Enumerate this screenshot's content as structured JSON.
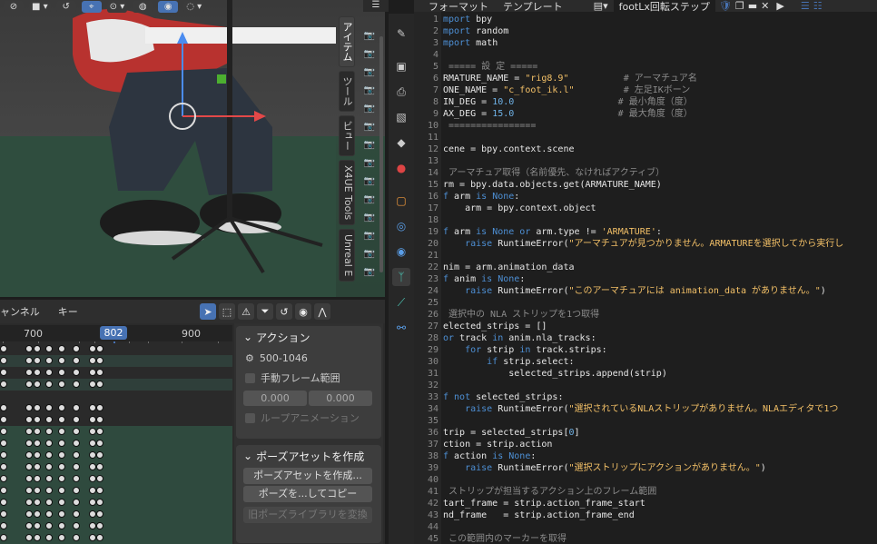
{
  "viewport": {
    "tabs": [
      "アイテム",
      "ツール",
      "ビュー",
      "X4UE Tools",
      "Unreal E"
    ]
  },
  "dopesheet": {
    "menu": [
      "ャンネル",
      "キー"
    ],
    "ruler": {
      "t700": "700",
      "t900": "900"
    },
    "current_frame": "802",
    "action_panel": {
      "title": "アクション",
      "range": "500-1046",
      "manual_range": "手動フレーム範囲",
      "start": "0.000",
      "end": "0.000",
      "loop": "ループアニメーション"
    },
    "pose_panel": {
      "title": "ポーズアセットを作成",
      "create": "ポーズアセットを作成...",
      "copy": "ポーズを...してコピー",
      "convert": "旧ポーズライブラリを変換"
    }
  },
  "editor": {
    "menu": [
      "フォーマット",
      "テンプレート"
    ],
    "filename": "footLx回転ステップ",
    "lines": [
      {
        "n": "1",
        "segs": [
          [
            "kw",
            "mport"
          ],
          [
            "",
            " bpy"
          ]
        ]
      },
      {
        "n": "2",
        "segs": [
          [
            "kw",
            "mport"
          ],
          [
            "",
            " random"
          ]
        ]
      },
      {
        "n": "3",
        "segs": [
          [
            "kw",
            "mport"
          ],
          [
            "",
            " math"
          ]
        ]
      },
      {
        "n": "4",
        "segs": []
      },
      {
        "n": "5",
        "segs": [
          [
            "cm",
            " ===== 設 定 ====="
          ]
        ]
      },
      {
        "n": "6",
        "segs": [
          [
            "",
            "RMATURE_NAME = "
          ],
          [
            "str",
            "\"rig8.9\""
          ],
          [
            "cm",
            "          # アーマチュア名"
          ]
        ]
      },
      {
        "n": "7",
        "segs": [
          [
            "",
            "ONE_NAME = "
          ],
          [
            "str",
            "\"c_foot_ik.l\""
          ],
          [
            "cm",
            "         # 左足IKボーン"
          ]
        ]
      },
      {
        "n": "8",
        "segs": [
          [
            "",
            "IN_DEG = "
          ],
          [
            "num",
            "10.0"
          ],
          [
            "cm",
            "                   # 最小角度（度）"
          ]
        ]
      },
      {
        "n": "9",
        "segs": [
          [
            "",
            "AX_DEG = "
          ],
          [
            "num",
            "15.0"
          ],
          [
            "cm",
            "                   # 最大角度（度）"
          ]
        ]
      },
      {
        "n": "10",
        "segs": [
          [
            "cm",
            " ================"
          ]
        ]
      },
      {
        "n": "11",
        "segs": []
      },
      {
        "n": "12",
        "segs": [
          [
            "",
            "cene = bpy.context.scene"
          ]
        ]
      },
      {
        "n": "13",
        "segs": []
      },
      {
        "n": "14",
        "segs": [
          [
            "cm",
            " アーマチュア取得（名前優先、なければアクティブ）"
          ]
        ]
      },
      {
        "n": "15",
        "segs": [
          [
            "",
            "rm = bpy.data.objects.get(ARMATURE_NAME)"
          ]
        ]
      },
      {
        "n": "16",
        "segs": [
          [
            "kw",
            "f"
          ],
          [
            "",
            " arm "
          ],
          [
            "kw",
            "is None"
          ],
          [
            "",
            ":"
          ]
        ]
      },
      {
        "n": "17",
        "segs": [
          [
            "",
            "    arm = bpy.context.object"
          ]
        ]
      },
      {
        "n": "18",
        "segs": []
      },
      {
        "n": "19",
        "segs": [
          [
            "kw",
            "f"
          ],
          [
            "",
            " arm "
          ],
          [
            "kw",
            "is None or"
          ],
          [
            "",
            " arm.type != "
          ],
          [
            "str",
            "'ARMATURE'"
          ],
          [
            "",
            ":"
          ]
        ]
      },
      {
        "n": "20",
        "segs": [
          [
            "",
            "    "
          ],
          [
            "kw",
            "raise"
          ],
          [
            "",
            " RuntimeError("
          ],
          [
            "str",
            "\"アーマチュアが見つかりません。ARMATUREを選択してから実行し"
          ]
        ]
      },
      {
        "n": "21",
        "segs": []
      },
      {
        "n": "22",
        "segs": [
          [
            "",
            "nim = arm.animation_data"
          ]
        ]
      },
      {
        "n": "23",
        "segs": [
          [
            "kw",
            "f"
          ],
          [
            "",
            " anim "
          ],
          [
            "kw",
            "is None"
          ],
          [
            "",
            ":"
          ]
        ]
      },
      {
        "n": "24",
        "segs": [
          [
            "",
            "    "
          ],
          [
            "kw",
            "raise"
          ],
          [
            "",
            " RuntimeError("
          ],
          [
            "str",
            "\"このアーマチュアには animation_data がありません。\""
          ],
          [
            "",
            ")"
          ]
        ]
      },
      {
        "n": "25",
        "segs": []
      },
      {
        "n": "26",
        "segs": [
          [
            "cm",
            " 選択中の NLA ストリップを1つ取得"
          ]
        ]
      },
      {
        "n": "27",
        "segs": [
          [
            "",
            "elected_strips = []"
          ]
        ]
      },
      {
        "n": "28",
        "segs": [
          [
            "kw",
            "or"
          ],
          [
            "",
            " track "
          ],
          [
            "kw",
            "in"
          ],
          [
            "",
            " anim.nla_tracks:"
          ]
        ]
      },
      {
        "n": "29",
        "segs": [
          [
            "",
            "    "
          ],
          [
            "kw",
            "for"
          ],
          [
            "",
            " strip "
          ],
          [
            "kw",
            "in"
          ],
          [
            "",
            " track.strips:"
          ]
        ]
      },
      {
        "n": "30",
        "segs": [
          [
            "",
            "        "
          ],
          [
            "kw",
            "if"
          ],
          [
            "",
            " strip.select:"
          ]
        ]
      },
      {
        "n": "31",
        "segs": [
          [
            "",
            "            selected_strips.append(strip)"
          ]
        ]
      },
      {
        "n": "32",
        "segs": []
      },
      {
        "n": "33",
        "segs": [
          [
            "kw",
            "f not"
          ],
          [
            "",
            " selected_strips:"
          ]
        ]
      },
      {
        "n": "34",
        "segs": [
          [
            "",
            "    "
          ],
          [
            "kw",
            "raise"
          ],
          [
            "",
            " RuntimeError("
          ],
          [
            "str",
            "\"選択されているNLAストリップがありません。NLAエディタで1つ"
          ]
        ]
      },
      {
        "n": "35",
        "segs": []
      },
      {
        "n": "36",
        "segs": [
          [
            "",
            "trip = selected_strips["
          ],
          [
            "num",
            "0"
          ],
          [
            "",
            "]"
          ]
        ]
      },
      {
        "n": "37",
        "segs": [
          [
            "",
            "ction = strip.action"
          ]
        ]
      },
      {
        "n": "38",
        "segs": [
          [
            "kw",
            "f"
          ],
          [
            "",
            " action "
          ],
          [
            "kw",
            "is None"
          ],
          [
            "",
            ":"
          ]
        ]
      },
      {
        "n": "39",
        "segs": [
          [
            "",
            "    "
          ],
          [
            "kw",
            "raise"
          ],
          [
            "",
            " RuntimeError("
          ],
          [
            "str",
            "\"選択ストリップにアクションがありません。\""
          ],
          [
            "",
            ")"
          ]
        ]
      },
      {
        "n": "40",
        "segs": []
      },
      {
        "n": "41",
        "segs": [
          [
            "cm",
            " ストリップが担当するアクション上のフレーム範囲"
          ]
        ]
      },
      {
        "n": "42",
        "segs": [
          [
            "",
            "tart_frame = strip.action_frame_start"
          ]
        ]
      },
      {
        "n": "43",
        "segs": [
          [
            "",
            "nd_frame   = strip.action_frame_end"
          ]
        ]
      },
      {
        "n": "44",
        "segs": []
      },
      {
        "n": "45",
        "segs": [
          [
            "cm",
            " この範囲内のマーカーを取得"
          ]
        ]
      }
    ]
  }
}
